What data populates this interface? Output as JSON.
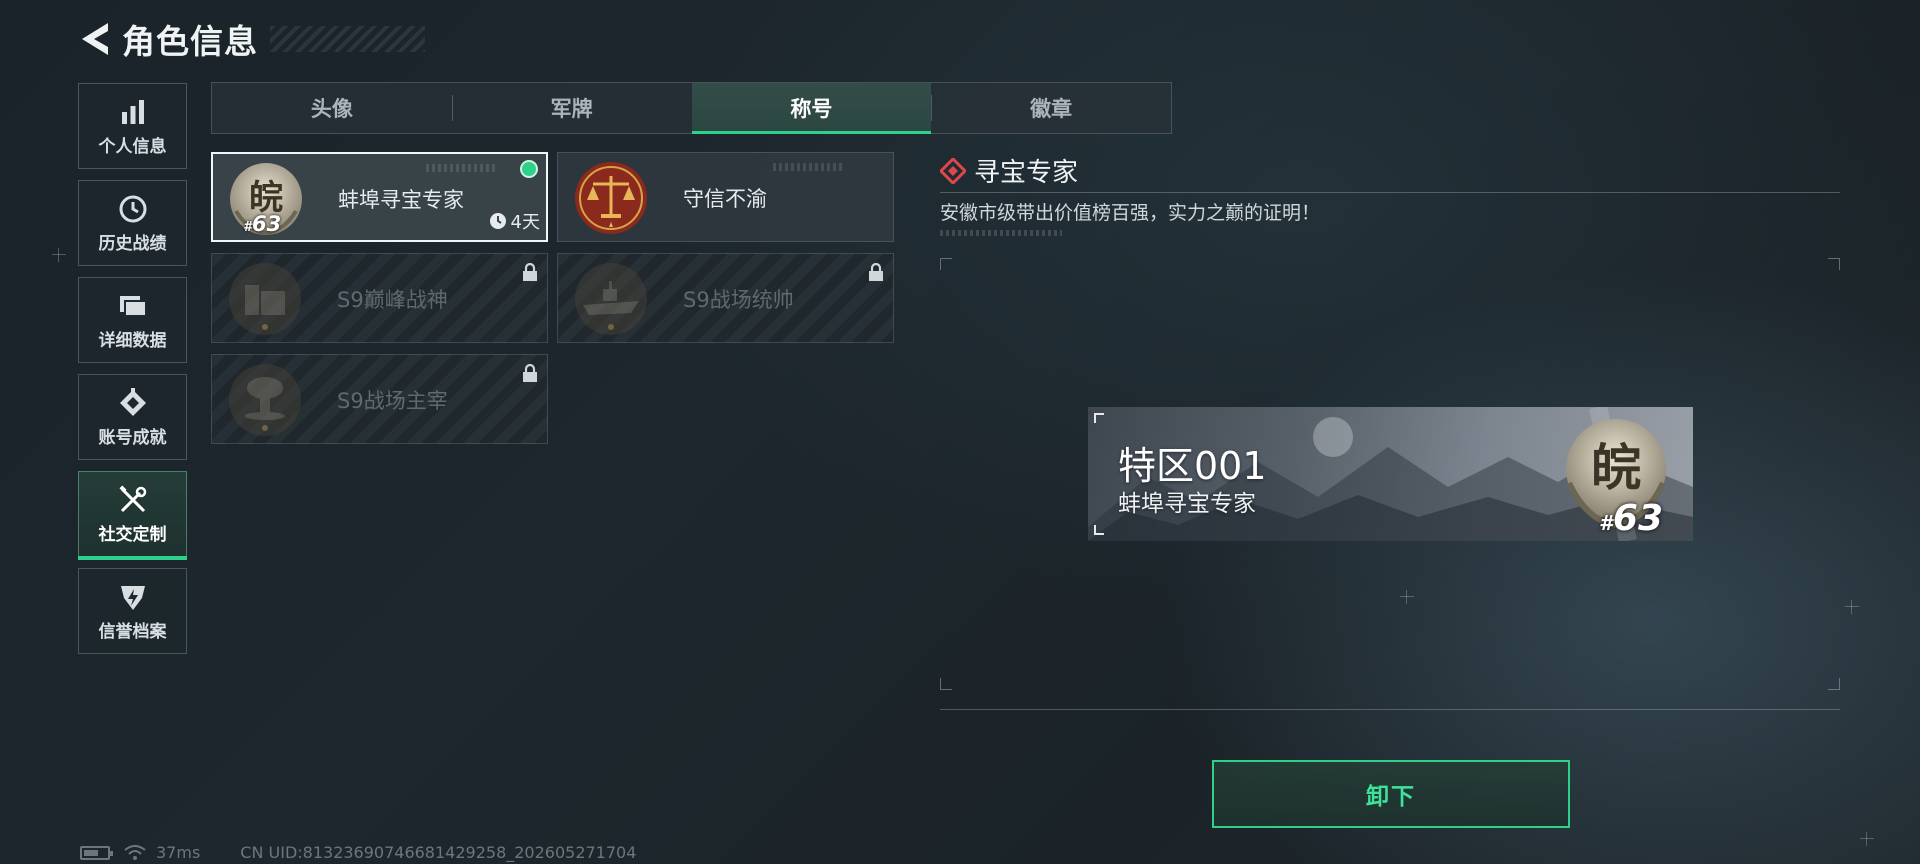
{
  "header": {
    "title": "角色信息"
  },
  "sidebar": {
    "items": [
      {
        "label": "个人信息",
        "icon": "bar-chart-icon",
        "active": false
      },
      {
        "label": "历史战绩",
        "icon": "clock-icon",
        "active": false
      },
      {
        "label": "详细数据",
        "icon": "folder-icon",
        "active": false
      },
      {
        "label": "账号成就",
        "icon": "achievement-icon",
        "active": false
      },
      {
        "label": "社交定制",
        "icon": "tools-icon",
        "active": true
      },
      {
        "label": "信誉档案",
        "icon": "shield-bolt-icon",
        "active": false
      }
    ]
  },
  "tabs": [
    {
      "label": "头像",
      "active": false
    },
    {
      "label": "军牌",
      "active": false
    },
    {
      "label": "称号",
      "active": true
    },
    {
      "label": "徽章",
      "active": false
    }
  ],
  "titles": [
    {
      "name": "蚌埠寻宝专家",
      "selected": true,
      "equipped": true,
      "locked": false,
      "timer": "4天",
      "rank": "63",
      "rank_prefix": "#",
      "emblem_glyph": "皖"
    },
    {
      "name": "守信不渝",
      "selected": false,
      "equipped": false,
      "locked": false
    },
    {
      "name": "S9巅峰战神",
      "selected": false,
      "equipped": false,
      "locked": true
    },
    {
      "name": "S9战场统帅",
      "selected": false,
      "equipped": false,
      "locked": true
    },
    {
      "name": "S9战场主宰",
      "selected": false,
      "equipped": false,
      "locked": true
    }
  ],
  "detail": {
    "title": "寻宝专家",
    "description": "安徽市级带出价值榜百强，实力之巅的证明！"
  },
  "nameplate": {
    "player_name": "特区001",
    "title": "蚌埠寻宝专家",
    "emblem_glyph": "皖",
    "rank_prefix": "#",
    "rank": "63"
  },
  "actions": {
    "unequip_label": "卸下"
  },
  "status": {
    "ping": "37ms",
    "uid": "CN UID:81323690746681429258_202605271704"
  },
  "colors": {
    "accent_green": "#2fd08a",
    "diamond_red": "#e0474c",
    "background": "#1d272d"
  }
}
